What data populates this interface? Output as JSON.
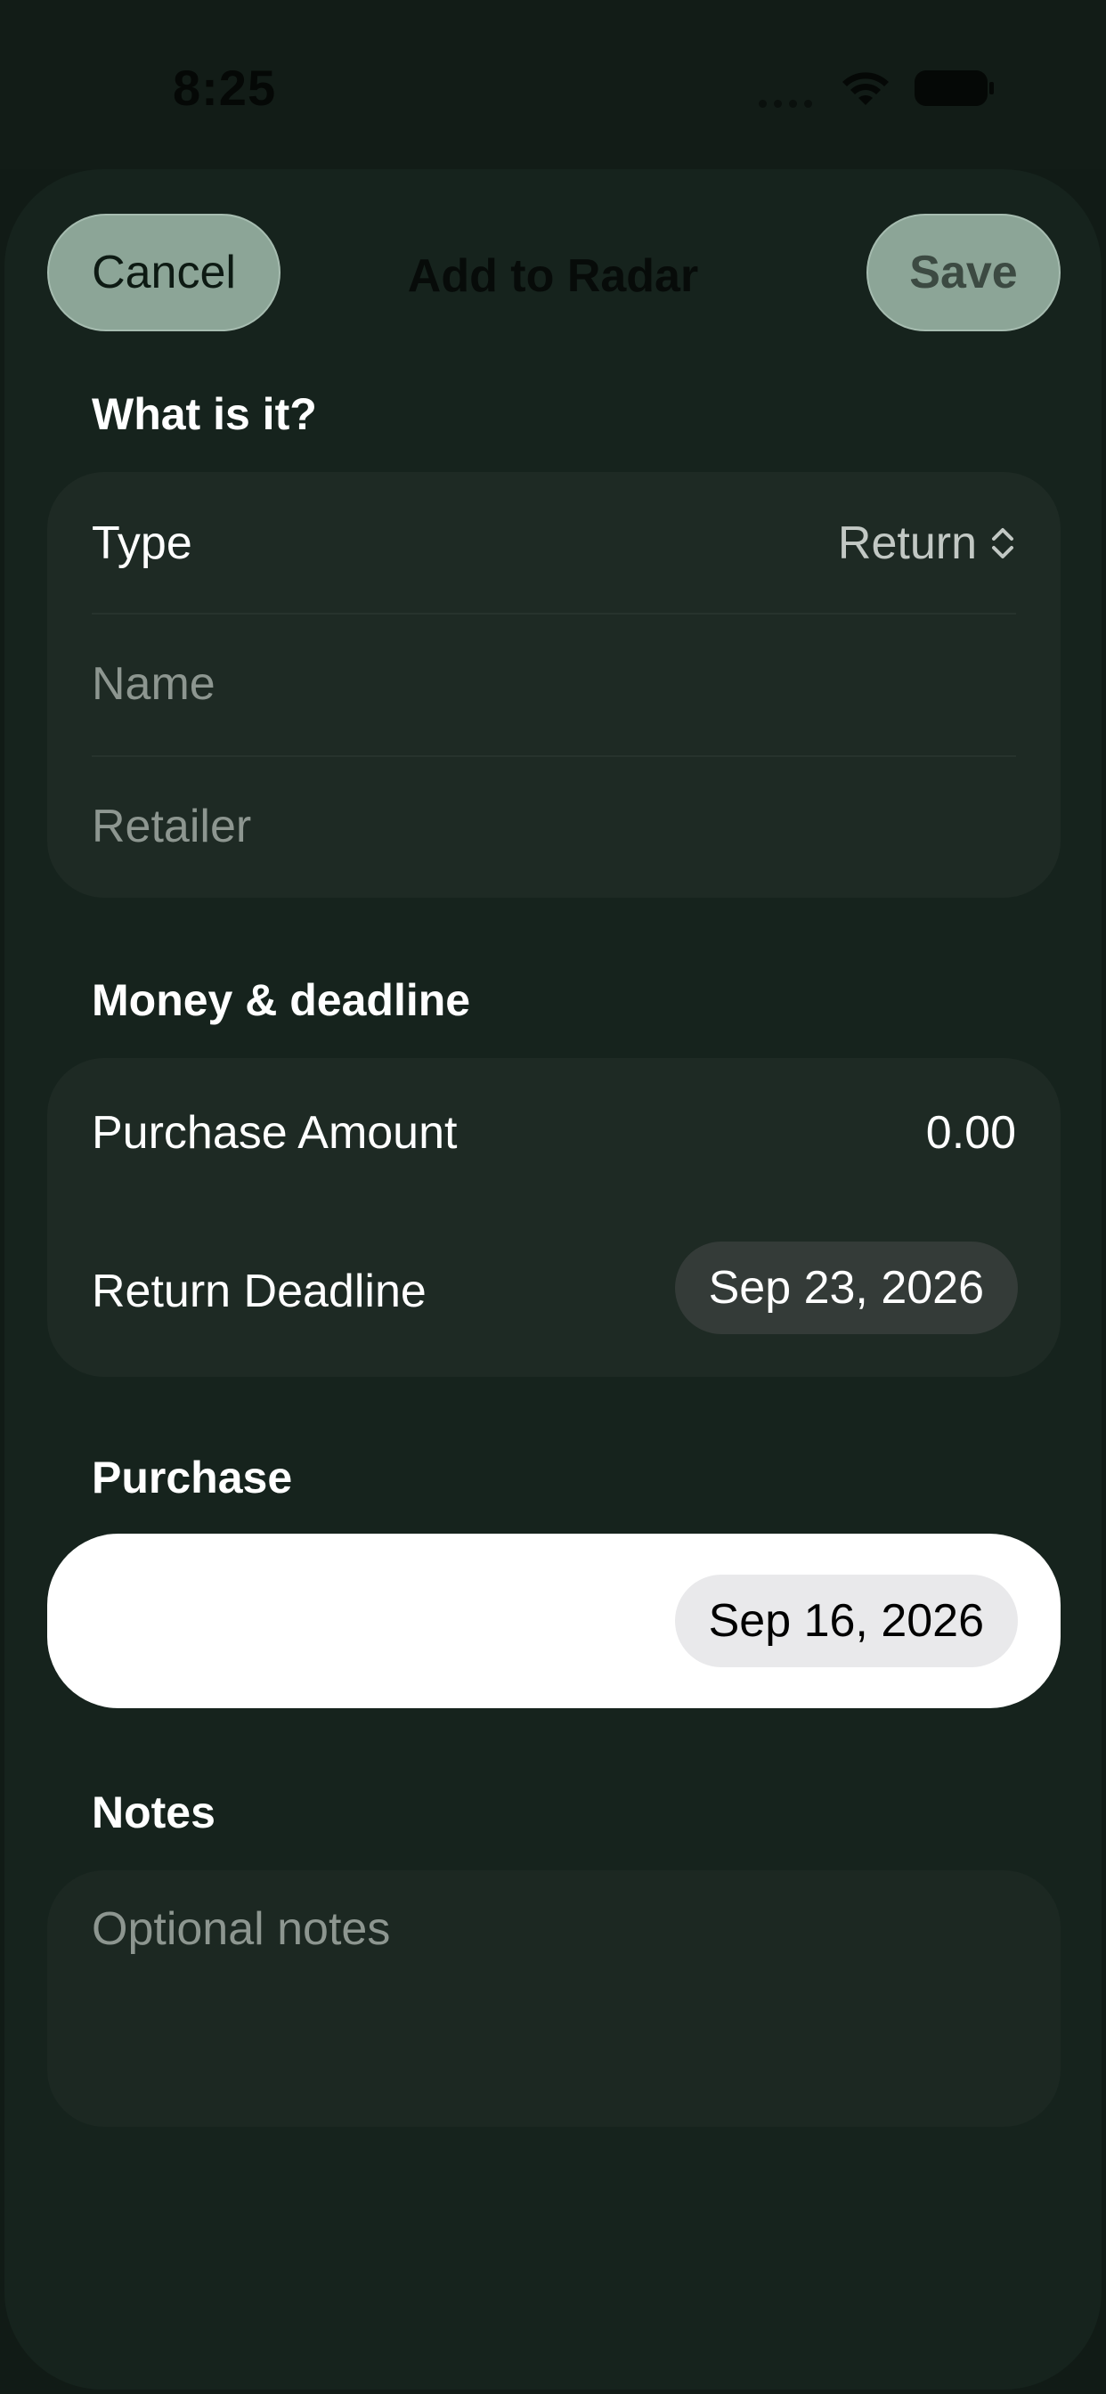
{
  "status_bar": {
    "time": "8:25",
    "icons": [
      "signal-dots-icon",
      "wifi-icon",
      "battery-icon"
    ]
  },
  "sheet": {
    "title": "Add to Radar",
    "cancel_label": "Cancel",
    "save_label": "Save"
  },
  "sections": {
    "what": {
      "header": "What is it?",
      "type_label": "Type",
      "type_value": "Return",
      "name_placeholder": "Name",
      "retailer_placeholder": "Retailer"
    },
    "money": {
      "header": "Money & deadline",
      "amount_label": "Purchase Amount",
      "amount_value": "0.00",
      "deadline_label": "Return Deadline",
      "deadline_value": "Sep 23, 2026"
    },
    "purchase": {
      "header": "Purchase",
      "date_value": "Sep 16, 2026"
    },
    "notes": {
      "header": "Notes",
      "placeholder": "Optional notes"
    }
  },
  "colors": {
    "background": "#111b16",
    "sheet": "#16231d",
    "group": "#1e2a24",
    "button": "#8ca597",
    "placeholder": "#8d9690"
  }
}
